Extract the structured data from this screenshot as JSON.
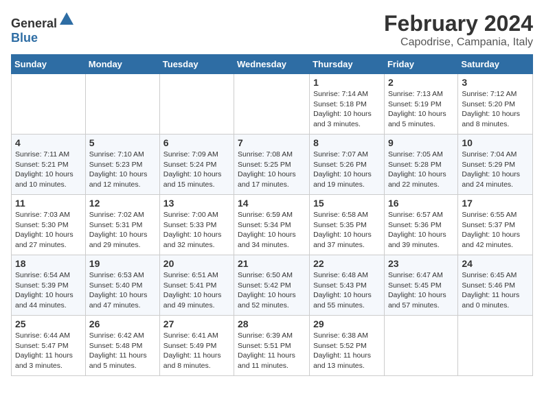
{
  "header": {
    "logo_general": "General",
    "logo_blue": "Blue",
    "title": "February 2024",
    "subtitle": "Capodrise, Campania, Italy"
  },
  "weekdays": [
    "Sunday",
    "Monday",
    "Tuesday",
    "Wednesday",
    "Thursday",
    "Friday",
    "Saturday"
  ],
  "weeks": [
    [
      {
        "day": "",
        "info": ""
      },
      {
        "day": "",
        "info": ""
      },
      {
        "day": "",
        "info": ""
      },
      {
        "day": "",
        "info": ""
      },
      {
        "day": "1",
        "info": "Sunrise: 7:14 AM\nSunset: 5:18 PM\nDaylight: 10 hours\nand 3 minutes."
      },
      {
        "day": "2",
        "info": "Sunrise: 7:13 AM\nSunset: 5:19 PM\nDaylight: 10 hours\nand 5 minutes."
      },
      {
        "day": "3",
        "info": "Sunrise: 7:12 AM\nSunset: 5:20 PM\nDaylight: 10 hours\nand 8 minutes."
      }
    ],
    [
      {
        "day": "4",
        "info": "Sunrise: 7:11 AM\nSunset: 5:21 PM\nDaylight: 10 hours\nand 10 minutes."
      },
      {
        "day": "5",
        "info": "Sunrise: 7:10 AM\nSunset: 5:23 PM\nDaylight: 10 hours\nand 12 minutes."
      },
      {
        "day": "6",
        "info": "Sunrise: 7:09 AM\nSunset: 5:24 PM\nDaylight: 10 hours\nand 15 minutes."
      },
      {
        "day": "7",
        "info": "Sunrise: 7:08 AM\nSunset: 5:25 PM\nDaylight: 10 hours\nand 17 minutes."
      },
      {
        "day": "8",
        "info": "Sunrise: 7:07 AM\nSunset: 5:26 PM\nDaylight: 10 hours\nand 19 minutes."
      },
      {
        "day": "9",
        "info": "Sunrise: 7:05 AM\nSunset: 5:28 PM\nDaylight: 10 hours\nand 22 minutes."
      },
      {
        "day": "10",
        "info": "Sunrise: 7:04 AM\nSunset: 5:29 PM\nDaylight: 10 hours\nand 24 minutes."
      }
    ],
    [
      {
        "day": "11",
        "info": "Sunrise: 7:03 AM\nSunset: 5:30 PM\nDaylight: 10 hours\nand 27 minutes."
      },
      {
        "day": "12",
        "info": "Sunrise: 7:02 AM\nSunset: 5:31 PM\nDaylight: 10 hours\nand 29 minutes."
      },
      {
        "day": "13",
        "info": "Sunrise: 7:00 AM\nSunset: 5:33 PM\nDaylight: 10 hours\nand 32 minutes."
      },
      {
        "day": "14",
        "info": "Sunrise: 6:59 AM\nSunset: 5:34 PM\nDaylight: 10 hours\nand 34 minutes."
      },
      {
        "day": "15",
        "info": "Sunrise: 6:58 AM\nSunset: 5:35 PM\nDaylight: 10 hours\nand 37 minutes."
      },
      {
        "day": "16",
        "info": "Sunrise: 6:57 AM\nSunset: 5:36 PM\nDaylight: 10 hours\nand 39 minutes."
      },
      {
        "day": "17",
        "info": "Sunrise: 6:55 AM\nSunset: 5:37 PM\nDaylight: 10 hours\nand 42 minutes."
      }
    ],
    [
      {
        "day": "18",
        "info": "Sunrise: 6:54 AM\nSunset: 5:39 PM\nDaylight: 10 hours\nand 44 minutes."
      },
      {
        "day": "19",
        "info": "Sunrise: 6:53 AM\nSunset: 5:40 PM\nDaylight: 10 hours\nand 47 minutes."
      },
      {
        "day": "20",
        "info": "Sunrise: 6:51 AM\nSunset: 5:41 PM\nDaylight: 10 hours\nand 49 minutes."
      },
      {
        "day": "21",
        "info": "Sunrise: 6:50 AM\nSunset: 5:42 PM\nDaylight: 10 hours\nand 52 minutes."
      },
      {
        "day": "22",
        "info": "Sunrise: 6:48 AM\nSunset: 5:43 PM\nDaylight: 10 hours\nand 55 minutes."
      },
      {
        "day": "23",
        "info": "Sunrise: 6:47 AM\nSunset: 5:45 PM\nDaylight: 10 hours\nand 57 minutes."
      },
      {
        "day": "24",
        "info": "Sunrise: 6:45 AM\nSunset: 5:46 PM\nDaylight: 11 hours\nand 0 minutes."
      }
    ],
    [
      {
        "day": "25",
        "info": "Sunrise: 6:44 AM\nSunset: 5:47 PM\nDaylight: 11 hours\nand 3 minutes."
      },
      {
        "day": "26",
        "info": "Sunrise: 6:42 AM\nSunset: 5:48 PM\nDaylight: 11 hours\nand 5 minutes."
      },
      {
        "day": "27",
        "info": "Sunrise: 6:41 AM\nSunset: 5:49 PM\nDaylight: 11 hours\nand 8 minutes."
      },
      {
        "day": "28",
        "info": "Sunrise: 6:39 AM\nSunset: 5:51 PM\nDaylight: 11 hours\nand 11 minutes."
      },
      {
        "day": "29",
        "info": "Sunrise: 6:38 AM\nSunset: 5:52 PM\nDaylight: 11 hours\nand 13 minutes."
      },
      {
        "day": "",
        "info": ""
      },
      {
        "day": "",
        "info": ""
      }
    ]
  ]
}
